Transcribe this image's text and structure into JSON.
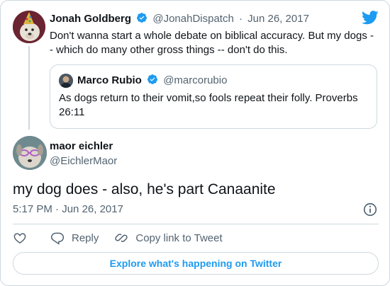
{
  "parent_tweet": {
    "author_name": "Jonah Goldberg",
    "handle": "@JonahDispatch",
    "separator": "·",
    "date": "Jun 26, 2017",
    "text": "Don't wanna start a whole debate on biblical accuracy. But my dogs -- which do many other gross things -- don't do this."
  },
  "quoted_tweet": {
    "author_name": "Marco Rubio",
    "handle": "@marcorubio",
    "text": "As dogs return to their vomit,so fools repeat their folly. Proverbs 26:11"
  },
  "main_tweet": {
    "author_name": "maor eichler",
    "handle": "@EichlerMaor",
    "text": "my dog does - also, he's part Canaanite",
    "time": "5:17 PM",
    "separator": "·",
    "date": "Jun 26, 2017"
  },
  "actions": {
    "reply_label": "Reply",
    "copy_link_label": "Copy link to Tweet"
  },
  "explore_label": "Explore what's happening on Twitter",
  "colors": {
    "accent": "#1d9bf0",
    "text": "#0f1419",
    "muted": "#536471",
    "border": "#cfd9de"
  },
  "icons": [
    "twitter-bird-icon",
    "verified-badge-icon",
    "info-icon",
    "heart-icon",
    "reply-icon",
    "link-icon"
  ]
}
